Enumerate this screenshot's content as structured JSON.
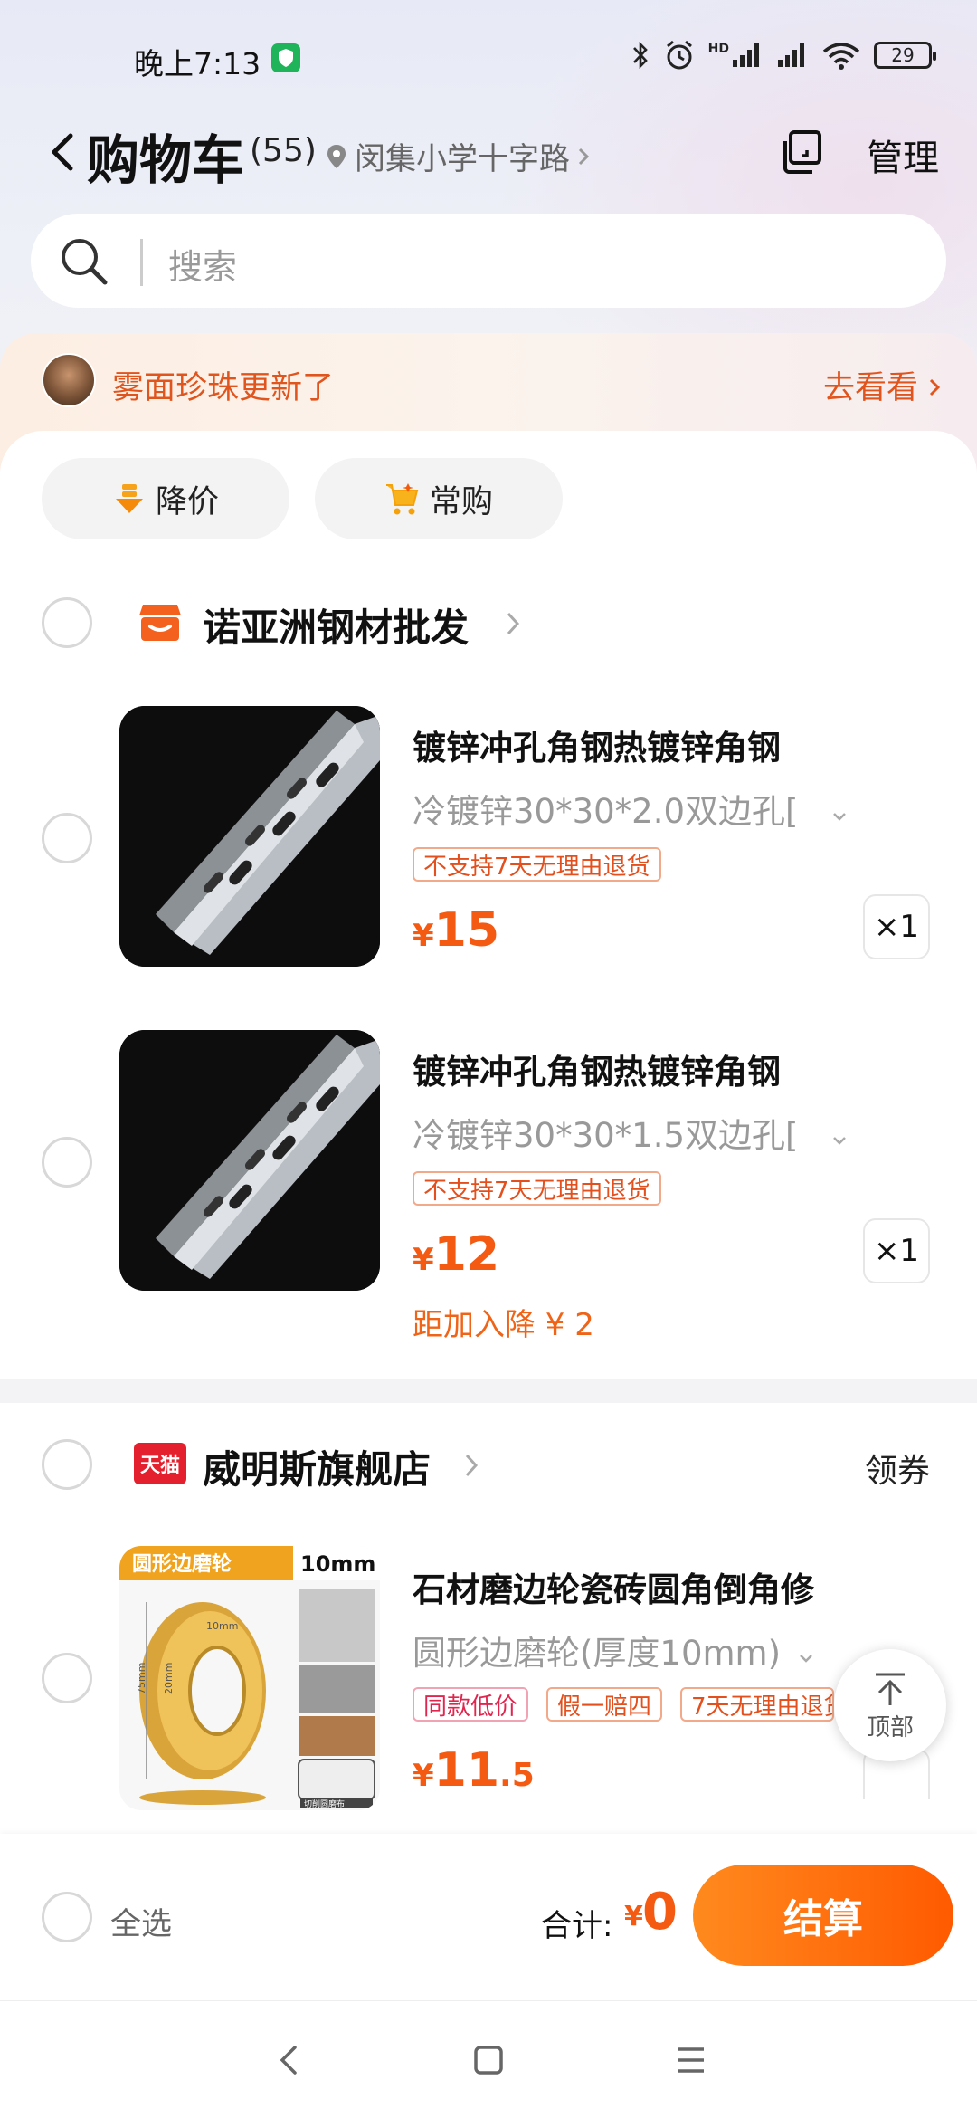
{
  "status_bar": {
    "time": "晚上7:13",
    "battery": "29",
    "network": "HD"
  },
  "header": {
    "title": "购物车",
    "count": "(55)",
    "location": "闵集小学十字路",
    "manage_label": "管理"
  },
  "search": {
    "placeholder": "搜索"
  },
  "notification": {
    "text": "雾面珍珠更新了",
    "link": "去看看"
  },
  "filters": [
    {
      "label": "降价"
    },
    {
      "label": "常购"
    }
  ],
  "stores": [
    {
      "name": "诺亚洲钢材批发",
      "items": [
        {
          "title": "镀锌冲孔角钢热镀锌角钢",
          "spec": "冷镀锌30*30*2.0双边孔[",
          "tags": [
            "不支持7天无理由退货"
          ],
          "currency": "¥",
          "price": "15",
          "qty": "×1"
        },
        {
          "title": "镀锌冲孔角钢热镀锌角钢",
          "spec": "冷镀锌30*30*1.5双边孔[",
          "tags": [
            "不支持7天无理由退货"
          ],
          "currency": "¥",
          "price": "12",
          "qty": "×1",
          "discount": "距加入降 ¥ 2"
        }
      ]
    },
    {
      "name": "威明斯旗舰店",
      "badge": "天猫",
      "coupon": "领券",
      "items": [
        {
          "title": "石材磨边轮瓷砖圆角倒角修",
          "spec": "圆形边磨轮(厚度10mm)",
          "tags": [
            "同款低价",
            "假一赔四",
            "7天无理由退货"
          ],
          "currency": "¥",
          "price": "11",
          "price_decimal": ".5",
          "image": {
            "banner": "圆形边磨轮",
            "size": "10mm",
            "dim_thickness": "10mm",
            "dim_inner": "20mm",
            "dim_outer": "75mm",
            "footer": "切削圆磨布"
          }
        }
      ]
    }
  ],
  "scroll_top": {
    "label": "顶部"
  },
  "bottom": {
    "select_all": "全选",
    "total_label": "合计:",
    "currency": "¥",
    "total": "0",
    "checkout": "结算"
  },
  "colors": {
    "accent": "#ff5a00",
    "price": "#f45a12",
    "tag_border": "#f2a98a"
  }
}
